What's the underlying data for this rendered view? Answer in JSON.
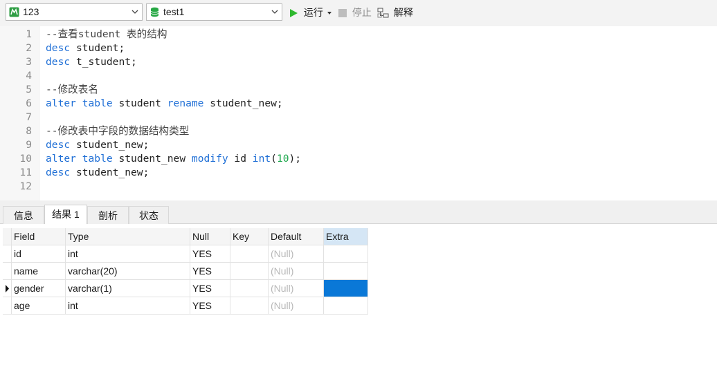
{
  "toolbar": {
    "connection": "123",
    "database": "test1",
    "run_label": "运行",
    "stop_label": "停止",
    "explain_label": "解释"
  },
  "editor": {
    "lines": [
      {
        "num": "1",
        "tokens": [
          {
            "t": "--查看student 表的结构",
            "c": "cm"
          }
        ]
      },
      {
        "num": "2",
        "tokens": [
          {
            "t": "desc",
            "c": "kw"
          },
          {
            "t": " student;",
            "c": "tx"
          }
        ]
      },
      {
        "num": "3",
        "tokens": [
          {
            "t": "desc",
            "c": "kw"
          },
          {
            "t": " t_student;",
            "c": "tx"
          }
        ]
      },
      {
        "num": "4",
        "tokens": []
      },
      {
        "num": "5",
        "tokens": [
          {
            "t": "--修改表名",
            "c": "cm"
          }
        ]
      },
      {
        "num": "6",
        "tokens": [
          {
            "t": "alter",
            "c": "kw"
          },
          {
            "t": " ",
            "c": "tx"
          },
          {
            "t": "table",
            "c": "kw"
          },
          {
            "t": " student ",
            "c": "tx"
          },
          {
            "t": "rename",
            "c": "kw"
          },
          {
            "t": " student_new;",
            "c": "tx"
          }
        ]
      },
      {
        "num": "7",
        "tokens": []
      },
      {
        "num": "8",
        "tokens": [
          {
            "t": "--修改表中字段的数据结构类型",
            "c": "cm"
          }
        ]
      },
      {
        "num": "9",
        "tokens": [
          {
            "t": "desc",
            "c": "kw"
          },
          {
            "t": " student_new;",
            "c": "tx"
          }
        ]
      },
      {
        "num": "10",
        "tokens": [
          {
            "t": "alter",
            "c": "kw"
          },
          {
            "t": " ",
            "c": "tx"
          },
          {
            "t": "table",
            "c": "kw"
          },
          {
            "t": " student_new ",
            "c": "tx"
          },
          {
            "t": "modify",
            "c": "kw"
          },
          {
            "t": " id ",
            "c": "tx"
          },
          {
            "t": "int",
            "c": "kw"
          },
          {
            "t": "(",
            "c": "tx"
          },
          {
            "t": "10",
            "c": "num"
          },
          {
            "t": ");",
            "c": "tx"
          }
        ]
      },
      {
        "num": "11",
        "tokens": [
          {
            "t": "desc",
            "c": "kw"
          },
          {
            "t": " student_new;",
            "c": "tx"
          }
        ]
      },
      {
        "num": "12",
        "tokens": []
      }
    ]
  },
  "tabs": [
    {
      "label": "信息",
      "active": false
    },
    {
      "label": "结果 1",
      "active": true
    },
    {
      "label": "剖析",
      "active": false
    },
    {
      "label": "状态",
      "active": false
    }
  ],
  "result": {
    "columns": [
      "Field",
      "Type",
      "Null",
      "Key",
      "Default",
      "Extra"
    ],
    "selected_column": "Extra",
    "rows": [
      {
        "Field": "id",
        "Type": "int",
        "Null": "YES",
        "Key": "",
        "Default": "(Null)",
        "Extra": ""
      },
      {
        "Field": "name",
        "Type": "varchar(20)",
        "Null": "YES",
        "Key": "",
        "Default": "(Null)",
        "Extra": ""
      },
      {
        "Field": "gender",
        "Type": "varchar(1)",
        "Null": "YES",
        "Key": "",
        "Default": "(Null)",
        "Extra": ""
      },
      {
        "Field": "age",
        "Type": "int",
        "Null": "YES",
        "Key": "",
        "Default": "(Null)",
        "Extra": ""
      }
    ],
    "current_row": 2,
    "selected_cell": "Extra"
  },
  "colors": {
    "keyword": "#1f6fd6",
    "number": "#1aa64a",
    "selection": "#0a78d7",
    "run_green": "#2eb82e"
  }
}
